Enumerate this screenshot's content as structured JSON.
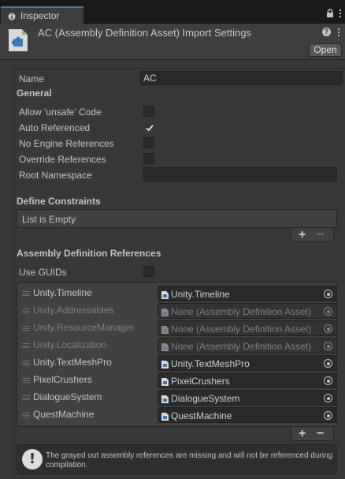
{
  "tab": {
    "label": "Inspector",
    "icon": "info-icon"
  },
  "header": {
    "title": "AC (Assembly Definition Asset) Import Settings",
    "open_label": "Open"
  },
  "name_field": {
    "label": "Name",
    "value": "AC"
  },
  "general": {
    "title": "General",
    "options": [
      {
        "label": "Allow 'unsafe' Code",
        "checked": false
      },
      {
        "label": "Auto Referenced",
        "checked": true
      },
      {
        "label": "No Engine References",
        "checked": false
      },
      {
        "label": "Override References",
        "checked": false
      }
    ],
    "root_namespace_label": "Root Namespace",
    "root_namespace_value": ""
  },
  "define_constraints": {
    "title": "Define Constraints",
    "empty_text": "List is Empty",
    "add_label": "+",
    "remove_label": "−"
  },
  "assembly_refs": {
    "title": "Assembly Definition References",
    "use_guids_label": "Use GUIDs",
    "use_guids_checked": false,
    "items": [
      {
        "label": "Unity.Timeline",
        "value": "Unity.Timeline",
        "missing": false
      },
      {
        "label": "Unity.Addressables",
        "value": "None (Assembly Definition Asset)",
        "missing": true
      },
      {
        "label": "Unity.ResourceManager",
        "value": "None (Assembly Definition Asset)",
        "missing": true
      },
      {
        "label": "Unity.Localization",
        "value": "None (Assembly Definition Asset)",
        "missing": true
      },
      {
        "label": "Unity.TextMeshPro",
        "value": "Unity.TextMeshPro",
        "missing": false
      },
      {
        "label": "PixelCrushers",
        "value": "PixelCrushers",
        "missing": false
      },
      {
        "label": "DialogueSystem",
        "value": "DialogueSystem",
        "missing": false
      },
      {
        "label": "QuestMachine",
        "value": "QuestMachine",
        "missing": false
      }
    ],
    "add_label": "+",
    "remove_label": "−"
  },
  "help_message": "The grayed out assembly references are missing and will not be referenced during compilation.",
  "colors": {
    "accent": "#3a79bb",
    "text": "#c4c4c4",
    "dim_text": "#808080",
    "field_bg": "#2a2a2a"
  }
}
